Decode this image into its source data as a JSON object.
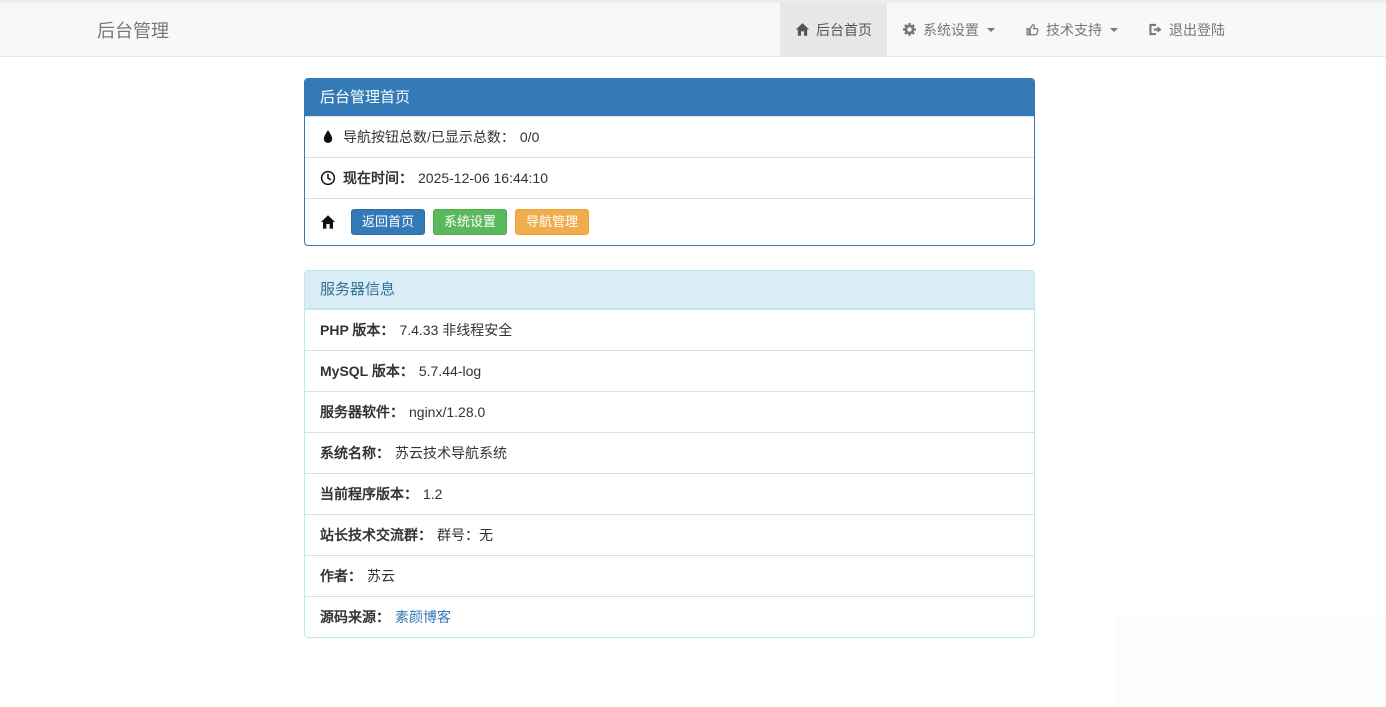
{
  "navbar": {
    "brand": "后台管理",
    "items": [
      {
        "label": "后台首页",
        "icon": "home-icon",
        "active": true,
        "caret": false
      },
      {
        "label": "系统设置",
        "icon": "gear-icon",
        "active": false,
        "caret": true
      },
      {
        "label": "技术支持",
        "icon": "thumbs-up-icon",
        "active": false,
        "caret": true
      },
      {
        "label": "退出登陆",
        "icon": "logout-icon",
        "active": false,
        "caret": false
      }
    ]
  },
  "admin_panel": {
    "title": "后台管理首页",
    "nav_count": {
      "icon": "tint-icon",
      "label": "导航按钮总数/已显示总数：",
      "value": "0/0"
    },
    "time": {
      "icon": "clock-icon",
      "label": "现在时间：",
      "value": "2025-12-06 16:44:10"
    },
    "shortcuts": {
      "icon": "home-icon",
      "buttons": [
        {
          "label": "返回首页",
          "color": "#337ab7"
        },
        {
          "label": "系统设置",
          "color": "#5cb85c"
        },
        {
          "label": "导航管理",
          "color": "#f0ad4e"
        }
      ]
    }
  },
  "server_panel": {
    "title": "服务器信息",
    "rows": [
      {
        "label": "PHP 版本：",
        "value": "7.4.33 非线程安全"
      },
      {
        "label": "MySQL 版本：",
        "value": "5.7.44-log"
      },
      {
        "label": "服务器软件：",
        "value": "nginx/1.28.0"
      },
      {
        "label": "系统名称：",
        "value": "苏云技术导航系统"
      },
      {
        "label": "当前程序版本：",
        "value": "1.2"
      },
      {
        "label": "站长技术交流群：",
        "value": "群号：无"
      },
      {
        "label": "作者：",
        "value": "苏云"
      },
      {
        "label": "源码来源：",
        "value": "素颜博客",
        "link": true
      }
    ]
  },
  "colors": {
    "primary": "#337ab7",
    "success": "#5cb85c",
    "warning": "#f0ad4e",
    "info_bg": "#d9edf7",
    "info_text": "#31708f",
    "info_border": "#bce8f1",
    "navbar_bg": "#f8f8f8",
    "navbar_active_bg": "#e7e7e7",
    "link": "#337ab7"
  }
}
